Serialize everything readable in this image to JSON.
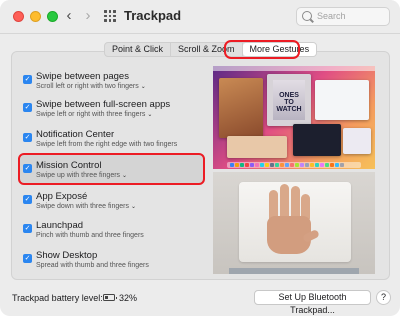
{
  "window": {
    "title": "Trackpad",
    "search_placeholder": "Search",
    "back_glyph": "‹",
    "forward_glyph": "›"
  },
  "tabs": [
    {
      "label": "Point & Click",
      "active": false
    },
    {
      "label": "Scroll & Zoom",
      "active": false
    },
    {
      "label": "More Gestures",
      "active": true
    }
  ],
  "options": [
    {
      "title": "Swipe between pages",
      "subtitle": "Scroll left or right with two fingers",
      "has_menu": true,
      "checked": true
    },
    {
      "title": "Swipe between full-screen apps",
      "subtitle": "Swipe left or right with three fingers",
      "has_menu": true,
      "checked": true
    },
    {
      "title": "Notification Center",
      "subtitle": "Swipe left from the right edge with two fingers",
      "has_menu": false,
      "checked": true
    },
    {
      "title": "Mission Control",
      "subtitle": "Swipe up with three fingers",
      "has_menu": true,
      "checked": true
    },
    {
      "title": "App Exposé",
      "subtitle": "Swipe down with three fingers",
      "has_menu": true,
      "checked": true
    },
    {
      "title": "Launchpad",
      "subtitle": "Pinch with thumb and three fingers",
      "has_menu": false,
      "checked": true
    },
    {
      "title": "Show Desktop",
      "subtitle": "Spread with thumb and three fingers",
      "has_menu": false,
      "checked": true
    }
  ],
  "preview": {
    "poster_text": "ONES TO WATCH"
  },
  "footer": {
    "battery_label": "Trackpad battery level:",
    "battery_value": "32%",
    "setup_button": "Set Up Bluetooth Trackpad...",
    "help_button": "?"
  },
  "colors": {
    "accent": "#2b86f0",
    "highlight": "#ec1c24"
  }
}
